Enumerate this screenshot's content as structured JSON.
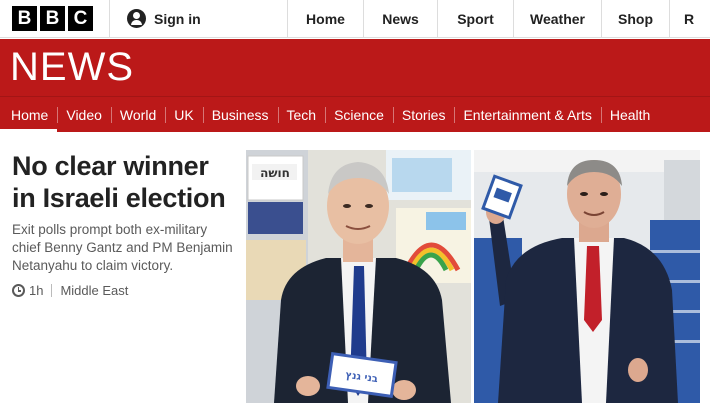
{
  "brand": {
    "letters": [
      "B",
      "B",
      "C"
    ],
    "section_wordmark": "NEWS"
  },
  "topbar": {
    "signin_label": "Sign in",
    "nav": [
      "Home",
      "News",
      "Sport",
      "Weather",
      "Shop",
      "R"
    ]
  },
  "section_nav": {
    "items": [
      "Home",
      "Video",
      "World",
      "UK",
      "Business",
      "Tech",
      "Science",
      "Stories",
      "Entertainment & Arts",
      "Health"
    ],
    "active": "Home"
  },
  "story": {
    "headline": "No clear winner in Israeli election",
    "summary": "Exit polls prompt both ex-military chief Benny Gantz and PM Benjamin Netanyahu to claim victory.",
    "age": "1h",
    "region": "Middle East"
  },
  "photos": {
    "left_sign_text": "חושה",
    "left_ballot_text": "בני גנץ"
  },
  "colors": {
    "brand_red": "#bb1919",
    "text": "#222222",
    "muted": "#5a5a5a"
  }
}
